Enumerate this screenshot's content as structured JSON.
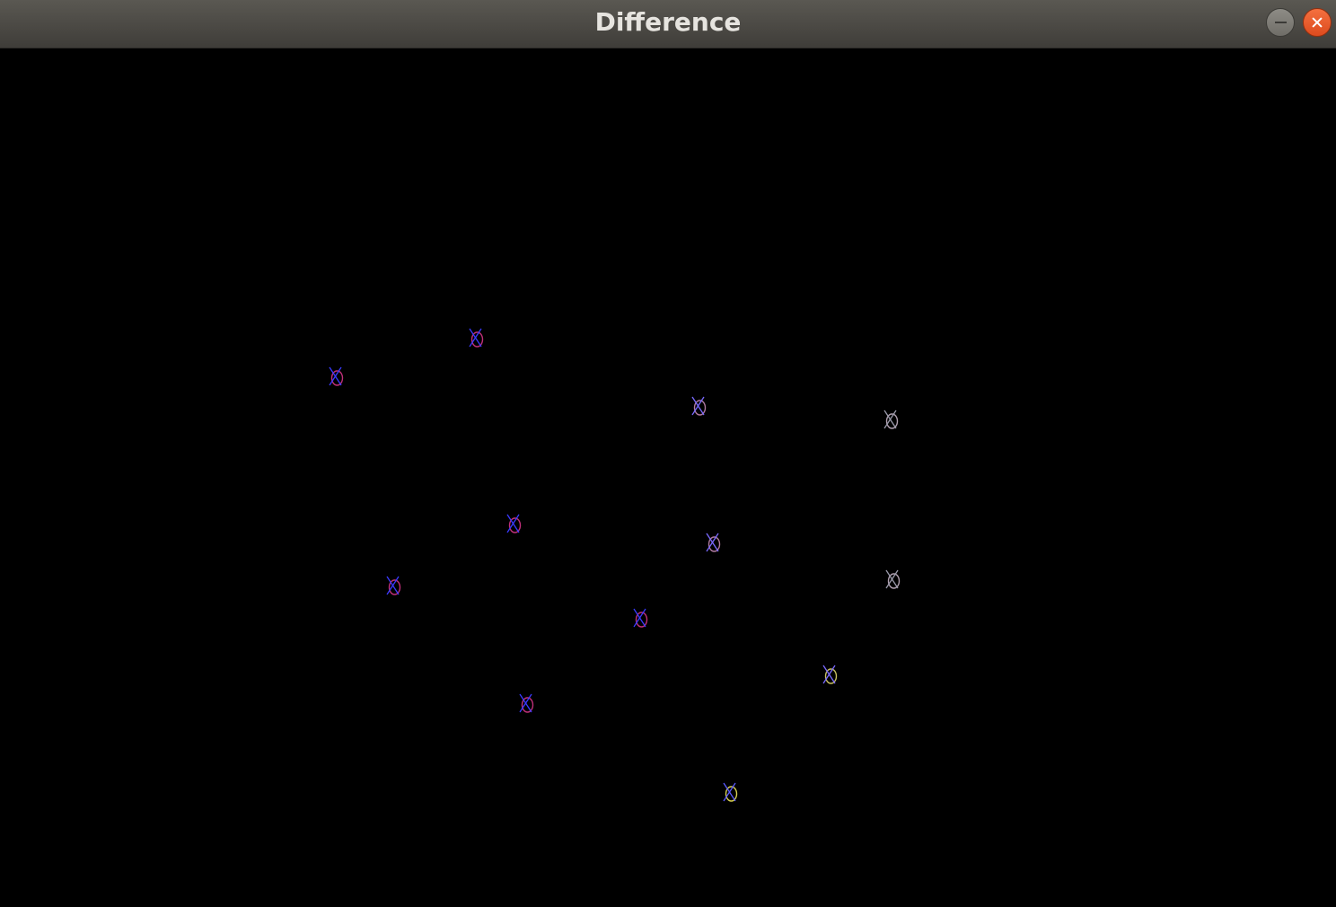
{
  "window": {
    "title": "Difference"
  },
  "colors": {
    "background": "#000000",
    "marker_cross": "#3a3aff",
    "marker_circle": "#c0307a"
  },
  "markers": [
    {
      "name": "marker-1",
      "cross_color": "#3a3aff",
      "circle_color": "#c0307a"
    },
    {
      "name": "marker-2",
      "cross_color": "#3a3aff",
      "circle_color": "#c0307a"
    },
    {
      "name": "marker-3",
      "cross_color": "#7a6aff",
      "circle_color": "#b07aa0"
    },
    {
      "name": "marker-4",
      "cross_color": "#9a9aaa",
      "circle_color": "#b0a0b0"
    },
    {
      "name": "marker-5",
      "cross_color": "#3a3aff",
      "circle_color": "#c0307a"
    },
    {
      "name": "marker-6",
      "cross_color": "#7a6aff",
      "circle_color": "#b07aa0"
    },
    {
      "name": "marker-7",
      "cross_color": "#3a3aff",
      "circle_color": "#c0307a"
    },
    {
      "name": "marker-8",
      "cross_color": "#9a9aaa",
      "circle_color": "#b0a0b0"
    },
    {
      "name": "marker-9",
      "cross_color": "#3a3aff",
      "circle_color": "#c0307a"
    },
    {
      "name": "marker-10",
      "cross_color": "#7a6aff",
      "circle_color": "#c8c060"
    },
    {
      "name": "marker-11",
      "cross_color": "#3a3aff",
      "circle_color": "#c0307a"
    },
    {
      "name": "marker-12",
      "cross_color": "#5a5aff",
      "circle_color": "#d8d050"
    }
  ]
}
